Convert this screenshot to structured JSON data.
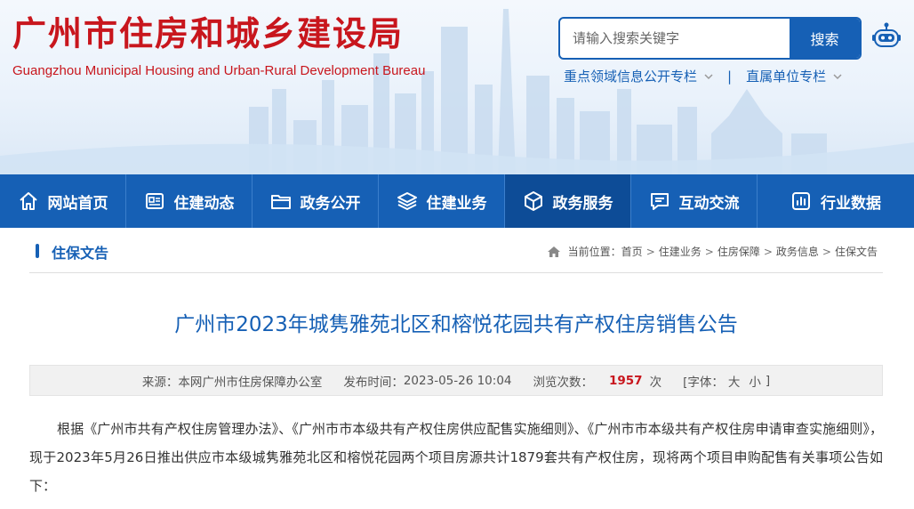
{
  "header": {
    "title": "广州市住房和城乡建设局",
    "subtitle": "Guangzhou Municipal Housing and Urban-Rural Development Bureau",
    "search": {
      "placeholder": "请输入搜索关键字",
      "button_label": "搜索"
    },
    "quick_links": [
      {
        "label": "重点领域信息公开专栏"
      },
      {
        "label": "直属单位专栏"
      }
    ],
    "separator": "|"
  },
  "nav": {
    "items": [
      {
        "label": "网站首页",
        "icon": "home-icon"
      },
      {
        "label": "住建动态",
        "icon": "news-icon"
      },
      {
        "label": "政务公开",
        "icon": "folder-icon"
      },
      {
        "label": "住建业务",
        "icon": "layers-icon"
      },
      {
        "label": "政务服务",
        "icon": "cube-icon",
        "active": true
      },
      {
        "label": "互动交流",
        "icon": "chat-icon"
      },
      {
        "label": "行业数据",
        "icon": "chart-icon"
      }
    ],
    "colors": {
      "bar": "#1660b5",
      "active": "#0d4c97"
    }
  },
  "column": {
    "title": "住保文告",
    "breadcrumb": {
      "prefix": "当前位置：",
      "items": [
        "首页",
        "住建业务",
        "住房保障",
        "政务信息",
        "住保文告"
      ],
      "separator": ">"
    }
  },
  "article": {
    "title": "广州市2023年城隽雅苑北区和榕悦花园共有产权住房销售公告",
    "meta": {
      "source_label": "来源：",
      "source": "本网广州市住房保障办公室",
      "time_label": "发布时间：",
      "time": "2023-05-26 10:04",
      "views_label": "浏览次数：",
      "views": "1957",
      "views_unit": "次",
      "font_label_open": "[字体：",
      "font_large": "大",
      "font_small": "小",
      "font_label_close": "]"
    },
    "body": "根据《广州市共有产权住房管理办法》、《广州市市本级共有产权住房供应配售实施细则》、《广州市市本级共有产权住房申请审查实施细则》，现于2023年5月26日推出供应市本级城隽雅苑北区和榕悦花园两个项目房源共计1879套共有产权住房，现将两个项目申购配售有关事项公告如下："
  },
  "colors": {
    "brand_red": "#c8161d",
    "brand_blue": "#1660b5"
  }
}
